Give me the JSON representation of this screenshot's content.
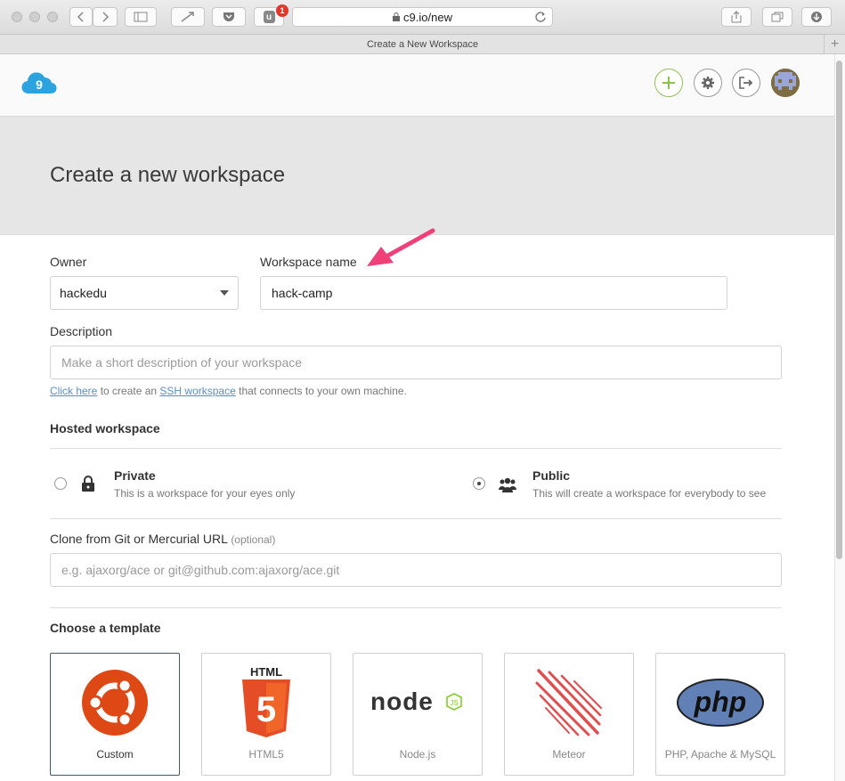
{
  "browser": {
    "url": "c9.io/new",
    "tab_title": "Create a New Workspace",
    "badge_count": "1",
    "extension_letter": "u"
  },
  "header": {
    "logo_text": "9"
  },
  "page": {
    "title": "Create a new workspace"
  },
  "form": {
    "owner_label": "Owner",
    "owner_value": "hackedu",
    "workspace_name_label": "Workspace name",
    "workspace_name_value": "hack-camp",
    "description_label": "Description",
    "description_placeholder": "Make a short description of your workspace",
    "hint_link_click": "Click here",
    "hint_text_1": " to create an ",
    "hint_link_ssh": "SSH workspace",
    "hint_text_2": " that connects to your own machine.",
    "hosted_title": "Hosted workspace",
    "private_title": "Private",
    "private_desc": "This is a workspace for your eyes only",
    "public_title": "Public",
    "public_desc": "This will create a workspace for everybody to see",
    "clone_label": "Clone from Git or Mercurial URL",
    "clone_optional": "(optional)",
    "clone_placeholder": "e.g. ajaxorg/ace or git@github.com:ajaxorg/ace.git",
    "template_title": "Choose a template"
  },
  "templates": [
    {
      "name": "Custom",
      "selected": true
    },
    {
      "name": "HTML5",
      "selected": false
    },
    {
      "name": "Node.js",
      "selected": false
    },
    {
      "name": "Meteor",
      "selected": false
    },
    {
      "name": "PHP, Apache & MySQL",
      "selected": false
    }
  ],
  "template_logos": {
    "html5_text": "HTML",
    "html5_digit": "5",
    "node_text": "node",
    "node_js": "JS",
    "php_text": "php"
  },
  "colors": {
    "accent_green": "#8cc152",
    "cloud_blue": "#2ba3e0",
    "ubuntu_orange": "#dd4814",
    "html5_orange": "#e44d26",
    "arrow_pink": "#f0407a",
    "php_blue": "#6181b6"
  }
}
